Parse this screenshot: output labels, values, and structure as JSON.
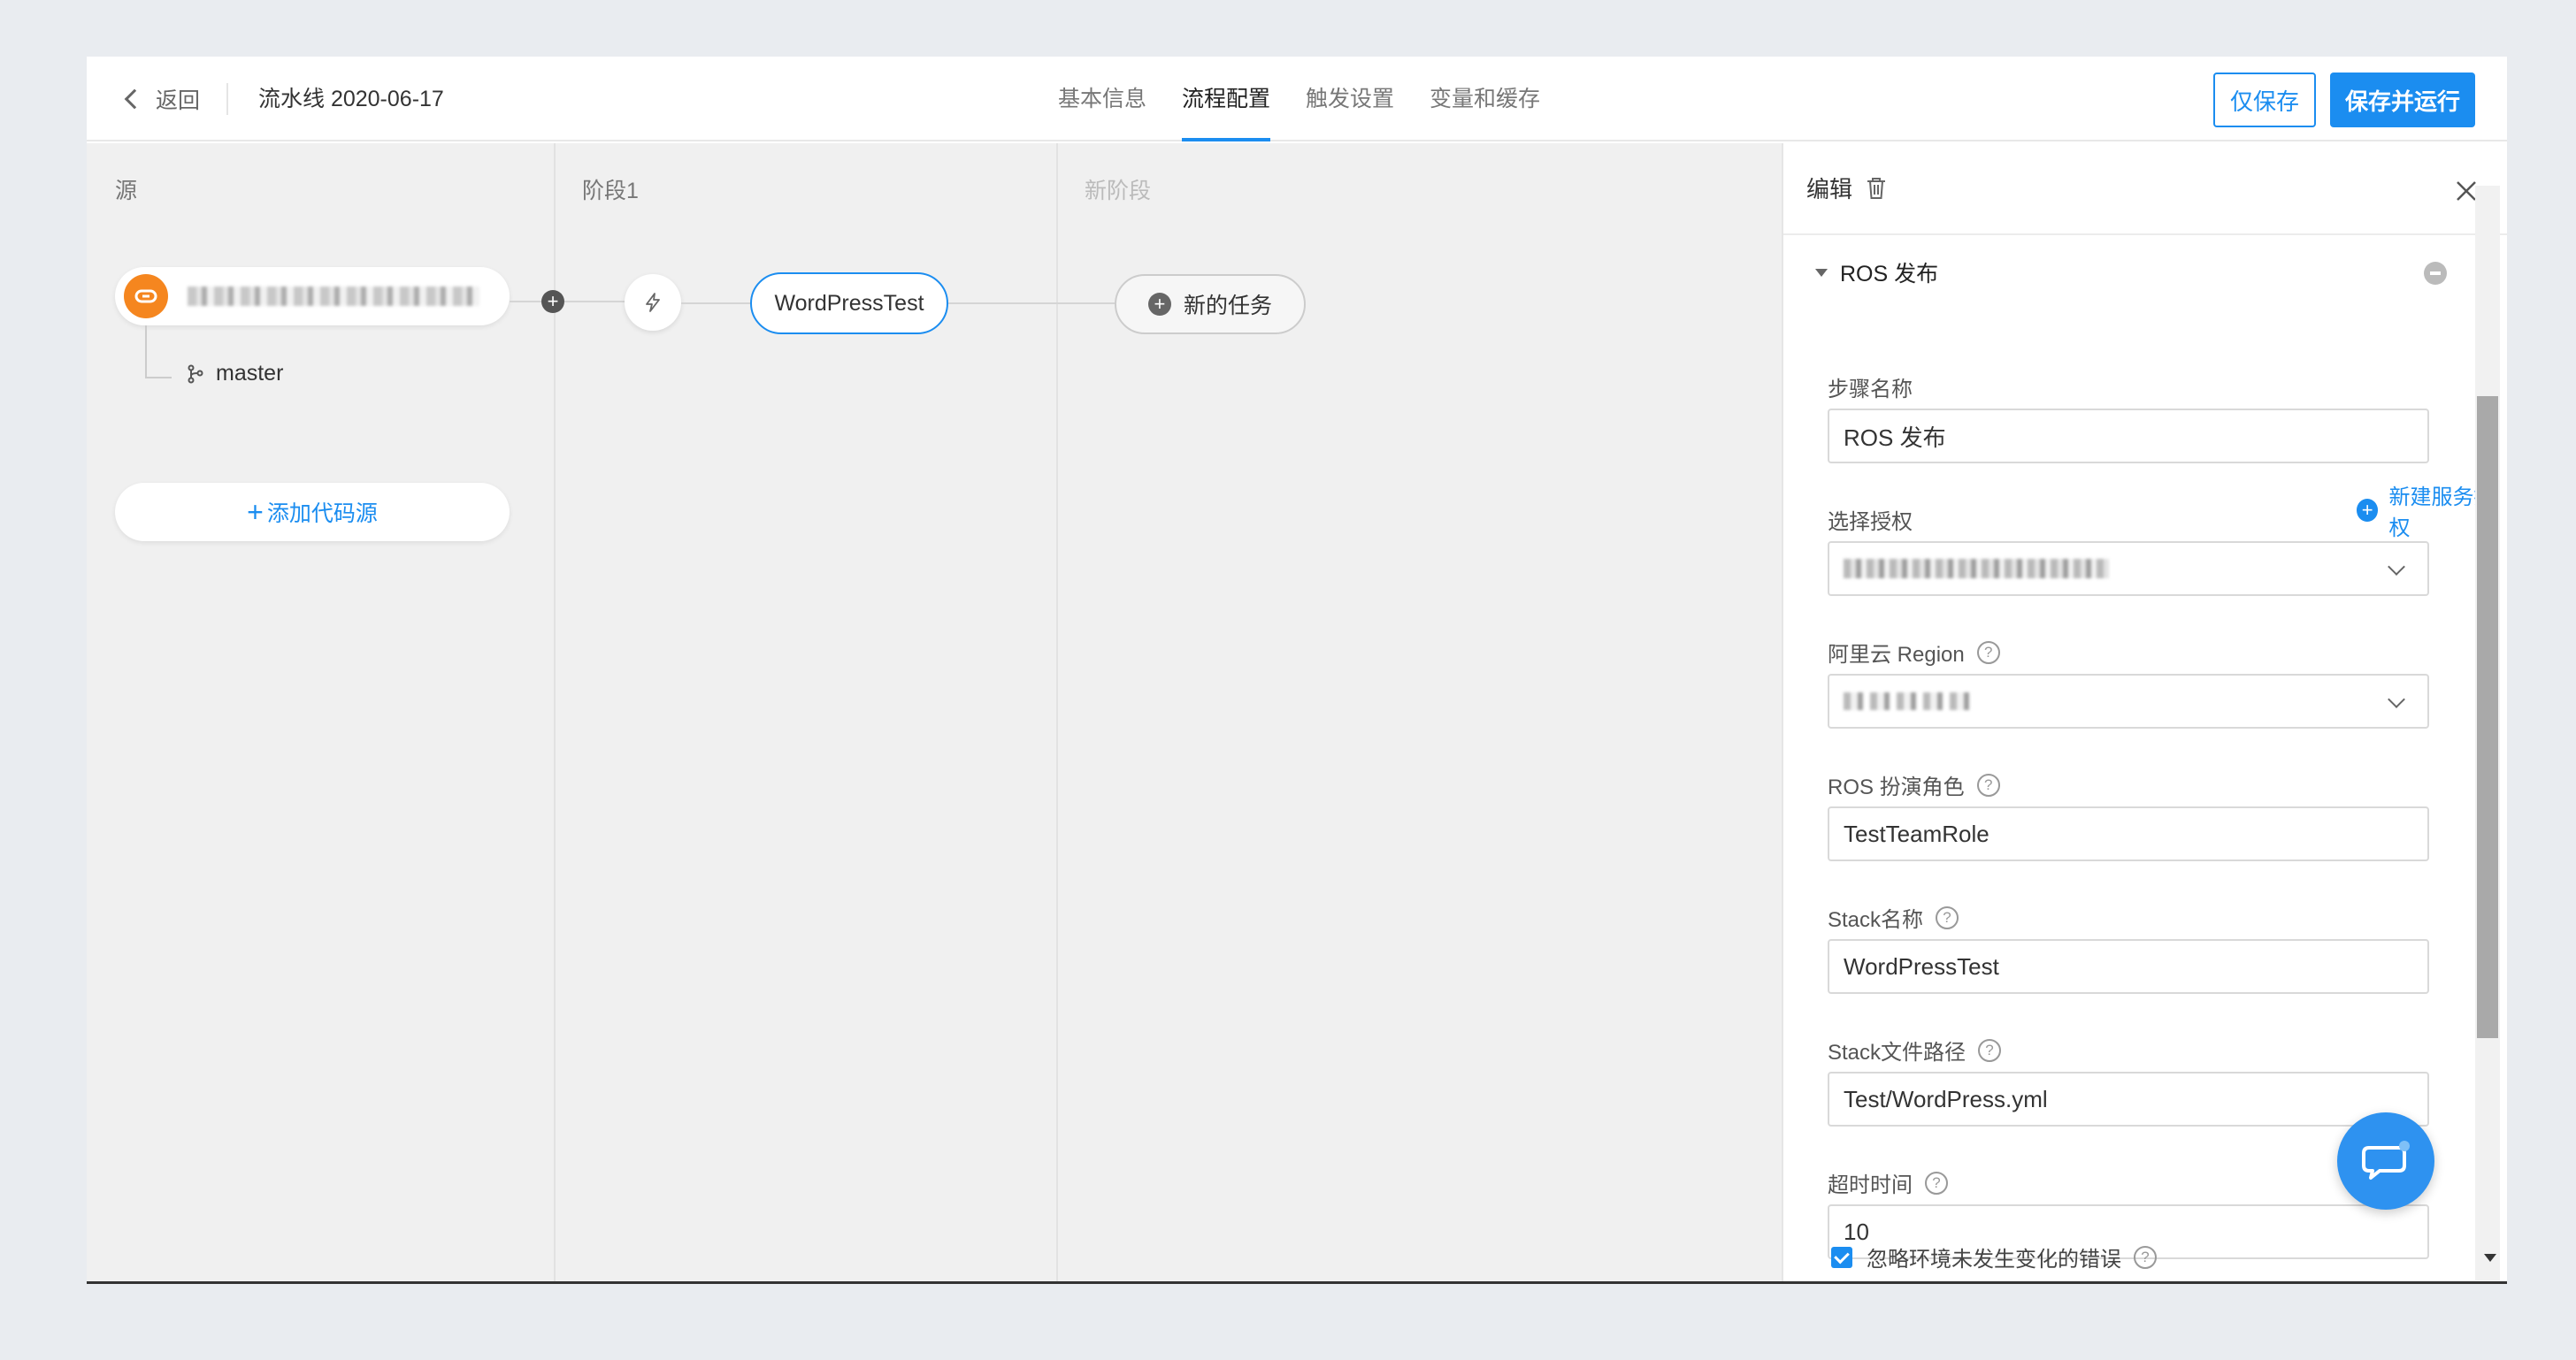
{
  "header": {
    "back_label": "返回",
    "pipeline_title": "流水线 2020-06-17",
    "tabs": [
      {
        "label": "基本信息"
      },
      {
        "label": "流程配置"
      },
      {
        "label": "触发设置"
      },
      {
        "label": "变量和缓存"
      }
    ],
    "active_tab": "流程配置",
    "save_only_label": "仅保存",
    "save_run_label": "保存并运行"
  },
  "canvas": {
    "columns": [
      {
        "title": "源"
      },
      {
        "title": "阶段1"
      },
      {
        "title": "新阶段"
      }
    ],
    "source": {
      "icon": "link-icon",
      "branch": "master"
    },
    "add_source_label": "添加代码源",
    "task_node_label": "WordPressTest",
    "new_task_label": "新的任务"
  },
  "panel": {
    "title": "编辑",
    "section_title": "ROS 发布",
    "fields": {
      "step_name": {
        "label": "步骤名称",
        "value": "ROS 发布"
      },
      "auth": {
        "label": "选择授权",
        "new_auth_label": "新建服务授权"
      },
      "region": {
        "label": "阿里云 Region"
      },
      "role": {
        "label": "ROS 扮演角色",
        "value": "TestTeamRole"
      },
      "stack_name": {
        "label": "Stack名称",
        "value": "WordPressTest"
      },
      "stack_file": {
        "label": "Stack文件路径",
        "value": "Test/WordPress.yml"
      },
      "timeout": {
        "label": "超时时间",
        "value": "10"
      }
    },
    "ignore_error_label": "忽略环境未发生变化的错误",
    "ignore_error_checked": true
  },
  "colors": {
    "accent": "#1b8df0",
    "source_icon": "#f5861f"
  }
}
